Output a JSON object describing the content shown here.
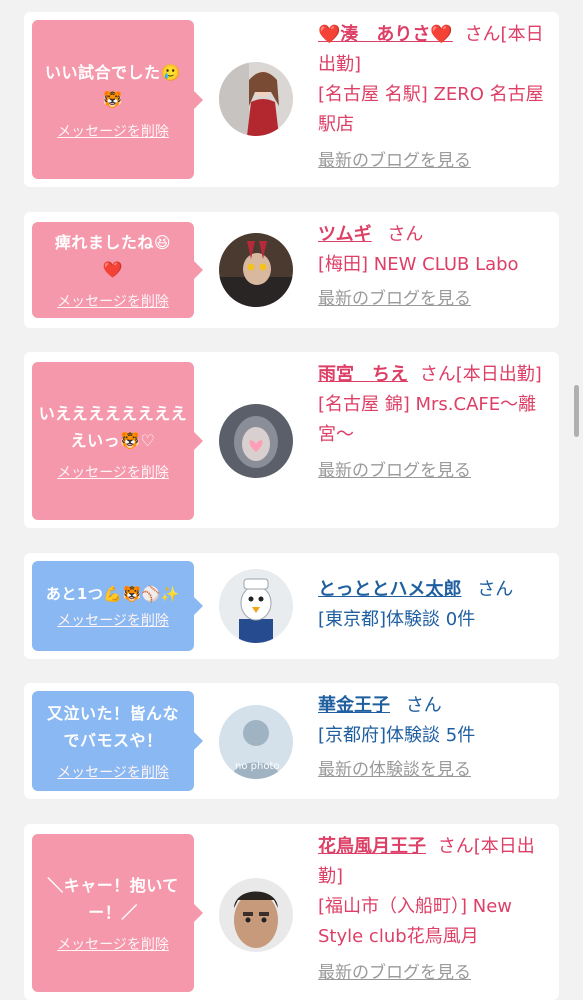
{
  "cards": [
    {
      "message": "いい試合でした🥲🐯",
      "delete_label": "メッセージを削除",
      "name": "❤️湊　ありさ❤️",
      "suffix": "さん[本日出勤]",
      "shop": "[名古屋 名駅] ZERO 名古屋駅店",
      "link": "最新のブログを見る",
      "theme": "pink"
    },
    {
      "message": "痺れましたね😆❤️",
      "delete_label": "メッセージを削除",
      "name": "ツムギ",
      "suffix": "さん",
      "shop": "[梅田] NEW CLUB Labo",
      "link": "最新のブログを見る",
      "theme": "pink"
    },
    {
      "message": "いえええええええええいっ🐯♡",
      "delete_label": "メッセージを削除",
      "name": "雨宮　ちえ",
      "suffix": "さん[本日出勤]",
      "shop": "[名古屋 錦] Mrs.CAFE〜離宮〜",
      "link": "最新のブログを見る",
      "theme": "pink"
    },
    {
      "message": "あと1つ💪🐯⚾✨",
      "delete_label": "メッセージを削除",
      "name": "とっととハメ太郎",
      "suffix": "さん",
      "shop": "[東京都]体験談 0件",
      "link": "",
      "theme": "blue"
    },
    {
      "message": "又泣いた！皆んなでバモスや！",
      "delete_label": "メッセージを削除",
      "name": "華金王子",
      "suffix": "さん",
      "shop": "[京都府]体験談 5件",
      "link": "最新の体験談を見る",
      "theme": "blue"
    },
    {
      "message": "＼キャー！抱いてー！／",
      "delete_label": "メッセージを削除",
      "name": "花鳥風月王子",
      "suffix": "さん[本日出勤]",
      "shop": "[福山市（入船町）] New Style club花鳥風月",
      "link": "最新のブログを見る",
      "theme": "pink"
    }
  ],
  "no_photo_text": "no photo",
  "colors": {
    "pink": "#f598ab",
    "blue": "#8ab8f2",
    "name_pink": "#dd3f66",
    "name_blue": "#1f5fa0"
  }
}
